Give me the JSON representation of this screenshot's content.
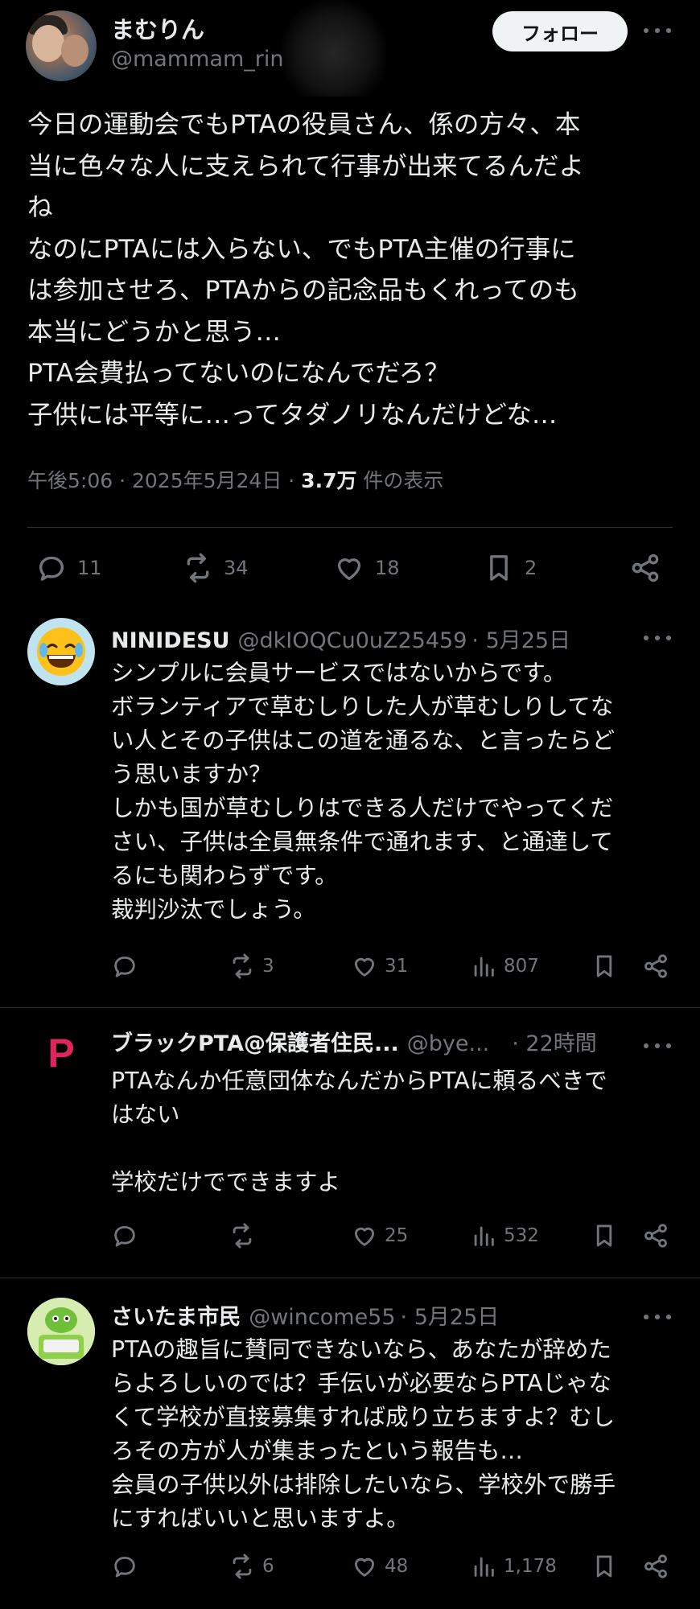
{
  "main_tweet": {
    "author_name": "まむりん",
    "author_handle": "@mammam_rin",
    "follow_label": "フォロー",
    "text": "今日の運動会でもPTAの役員さん、係の方々、本\n当に色々な人に支えられて行事が出来てるんだよ\nね\nなのにPTAには入らない、でもPTA主催の行事に\nは参加させろ、PTAからの記念品もくれってのも\n本当にどうかと思う…\nPTA会費払ってないのになんでだろ？\n子供には平等に…ってタダノリなんだけどな…",
    "time": "午後5:06 · 2025年5月24日 · ",
    "views_count": "3.7万",
    "views_label": " 件の表示",
    "replies": "11",
    "retweets": "34",
    "likes": "18",
    "bookmarks": "2"
  },
  "replies": [
    {
      "name": "NINIDESU",
      "handle": "@dkIOQCu0uZ25459",
      "date": "· 5月25日",
      "avatar_icon": "laughing-emoji-icon",
      "text": "シンプルに会員サービスではないからです。\nボランティアで草むしりした人が草むしりしてな\nい人とその子供はこの道を通るな、と言ったらど\nう思いますか？\nしかも国が草むしりはできる人だけでやってくだ\nさい、子供は全員無条件で通れます、と通達して\nるにも関わらずです。\n裁判沙汰でしょう。",
      "replies": "",
      "retweets": "3",
      "likes": "31",
      "views": "807"
    },
    {
      "name": "ブラックPTA@保護者住民...",
      "handle": "@bye...",
      "date": "· 22時間",
      "avatar_letter": "P",
      "text": "PTAなんか任意団体なんだからPTAに頼るべきで\nはない\n\n学校だけでできますよ",
      "replies": "",
      "retweets": "",
      "likes": "25",
      "views": "532"
    },
    {
      "name": "さいたま市民",
      "handle": "@wincome55",
      "date": "· 5月25日",
      "avatar_icon": "green-mascot-icon",
      "text": "PTAの趣旨に賛同できないなら、あなたが辞めた\nらよろしいのでは？手伝いが必要ならPTAじゃな\nくて学校が直接募集すれば成り立ちますよ？むし\nろその方が人が集まったという報告も…\n会員の子供以外は排除したいなら、学校外で勝手\nにすればいいと思いますよ。",
      "replies": "",
      "retweets": "6",
      "likes": "48",
      "views": "1,178"
    }
  ],
  "colors": {
    "background": "#000000",
    "text": "#e7e9ea",
    "secondary": "#71767b",
    "divider": "#2f3336",
    "brand_p": "#e0245e"
  }
}
